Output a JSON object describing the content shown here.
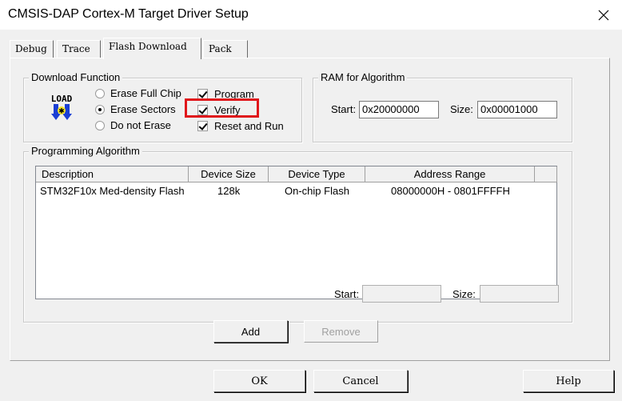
{
  "window": {
    "title": "CMSIS-DAP Cortex-M Target Driver Setup",
    "close_glyph": "✕"
  },
  "tabs": [
    {
      "label": "Debug",
      "active": false
    },
    {
      "label": "Trace",
      "active": false
    },
    {
      "label": "Flash Download",
      "active": true
    },
    {
      "label": "Pack",
      "active": false
    }
  ],
  "download_function": {
    "group_label": "Download Function",
    "load_icon_text": "LOAD",
    "radios": [
      {
        "label": "Erase Full Chip",
        "selected": false
      },
      {
        "label": "Erase Sectors",
        "selected": true
      },
      {
        "label": "Do not Erase",
        "selected": false
      }
    ],
    "checks": [
      {
        "label": "Program",
        "checked": true
      },
      {
        "label": "Verify",
        "checked": true
      },
      {
        "label": "Reset and Run",
        "checked": true
      }
    ],
    "highlight_color": "#e0161b"
  },
  "ram": {
    "group_label": "RAM for Algorithm",
    "start_label": "Start:",
    "start_value": "0x20000000",
    "size_label": "Size:",
    "size_value": "0x00001000"
  },
  "programming_algorithm": {
    "group_label": "Programming Algorithm",
    "columns": [
      "Description",
      "Device Size",
      "Device Type",
      "Address Range"
    ],
    "rows": [
      [
        "STM32F10x Med-density Flash",
        "128k",
        "On-chip Flash",
        "08000000H - 0801FFFFH"
      ]
    ],
    "start_label": "Start:",
    "start_value": "",
    "size_label": "Size:",
    "size_value": ""
  },
  "buttons": {
    "add": "Add",
    "remove": "Remove",
    "ok": "OK",
    "cancel": "Cancel",
    "help": "Help"
  }
}
